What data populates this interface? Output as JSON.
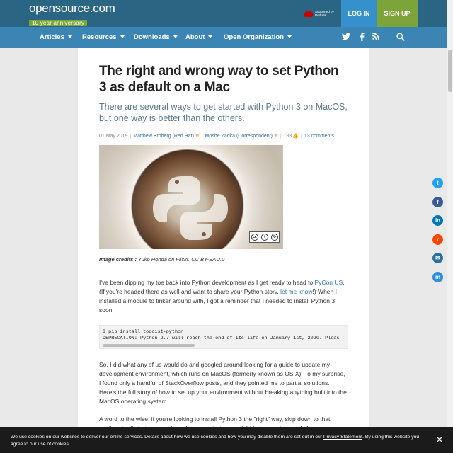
{
  "header": {
    "logo": "opensource.com",
    "logo_sub": "10 year anniversary",
    "redhat_text": "Supported by Red Hat",
    "login": "LOG IN",
    "signup": "SIGN UP"
  },
  "nav": {
    "items": [
      {
        "label": "Articles"
      },
      {
        "label": "Resources"
      },
      {
        "label": "Downloads"
      },
      {
        "label": "About"
      },
      {
        "label": "Open Organization"
      }
    ],
    "icons": [
      "twitter-icon",
      "facebook-icon",
      "rss-icon",
      "search-icon"
    ]
  },
  "article": {
    "title": "The right and wrong way to set Python 3 as default on a Mac",
    "subtitle": "There are several ways to get started with Python 3 on MacOS, but one way is better than the others.",
    "date": "01 May 2019",
    "author1": "Matthew Broberg (Red Hat)",
    "author2": "Moshe Zadka (Correspondent)",
    "views": "183",
    "comments": "13 comments",
    "image_credit_label": "Image credits :",
    "image_credit": "Yuko Honda on Flickr. CC BY-SA 2.0",
    "p1_a": "I've been dipping my toe back into Python development as I get ready to head to ",
    "p1_link1": "PyCon US",
    "p1_b": ". (If you're headed there as well and want to share your Python story, ",
    "p1_link2": "let me know",
    "p1_c": "!) When I installed a module to tinker around with, I got a reminder that I needed to install Python 3 soon.",
    "code_line1": "$ pip install todoist-python",
    "code_line2": "DEPRECATION: Python 2.7 will reach the end of its life on January 1st, 2020. Pleas",
    "p2": "So, I did what any of us would do and googled around looking for a guide to update my development environment, which runs on MacOS (formerly known as OS X). To my surprise, I found only a handful of StackOverflow posts, and they pointed me to partial solutions. Here's the full story of how to set up your environment without breaking anything built into the MacOS operating system.",
    "p3": "A word to the wise: if you're looking to install Python 3 the \"right\" way, skip down to that section. I will start by covering other ways that seem right but are not a good idea."
  },
  "share_icons": [
    {
      "name": "twitter-share-icon",
      "glyph": "t",
      "color": "#1da1f2"
    },
    {
      "name": "facebook-share-icon",
      "glyph": "f",
      "color": "#3b5998"
    },
    {
      "name": "linkedin-share-icon",
      "glyph": "in",
      "color": "#0077b5"
    },
    {
      "name": "reddit-share-icon",
      "glyph": "r",
      "color": "#ff4500"
    },
    {
      "name": "email-share-icon",
      "glyph": "✉",
      "color": "#2a6f9e"
    },
    {
      "name": "mastodon-share-icon",
      "glyph": "m",
      "color": "#2b90d9"
    }
  ],
  "cookie": {
    "text_a": "We use cookies on our websites to deliver our online services. Details about how we use cookies and how you may disable them are set out in our ",
    "link": "Privacy Statement",
    "text_b": ". By using this website you agree to our use of cookies.",
    "close": "✕"
  }
}
